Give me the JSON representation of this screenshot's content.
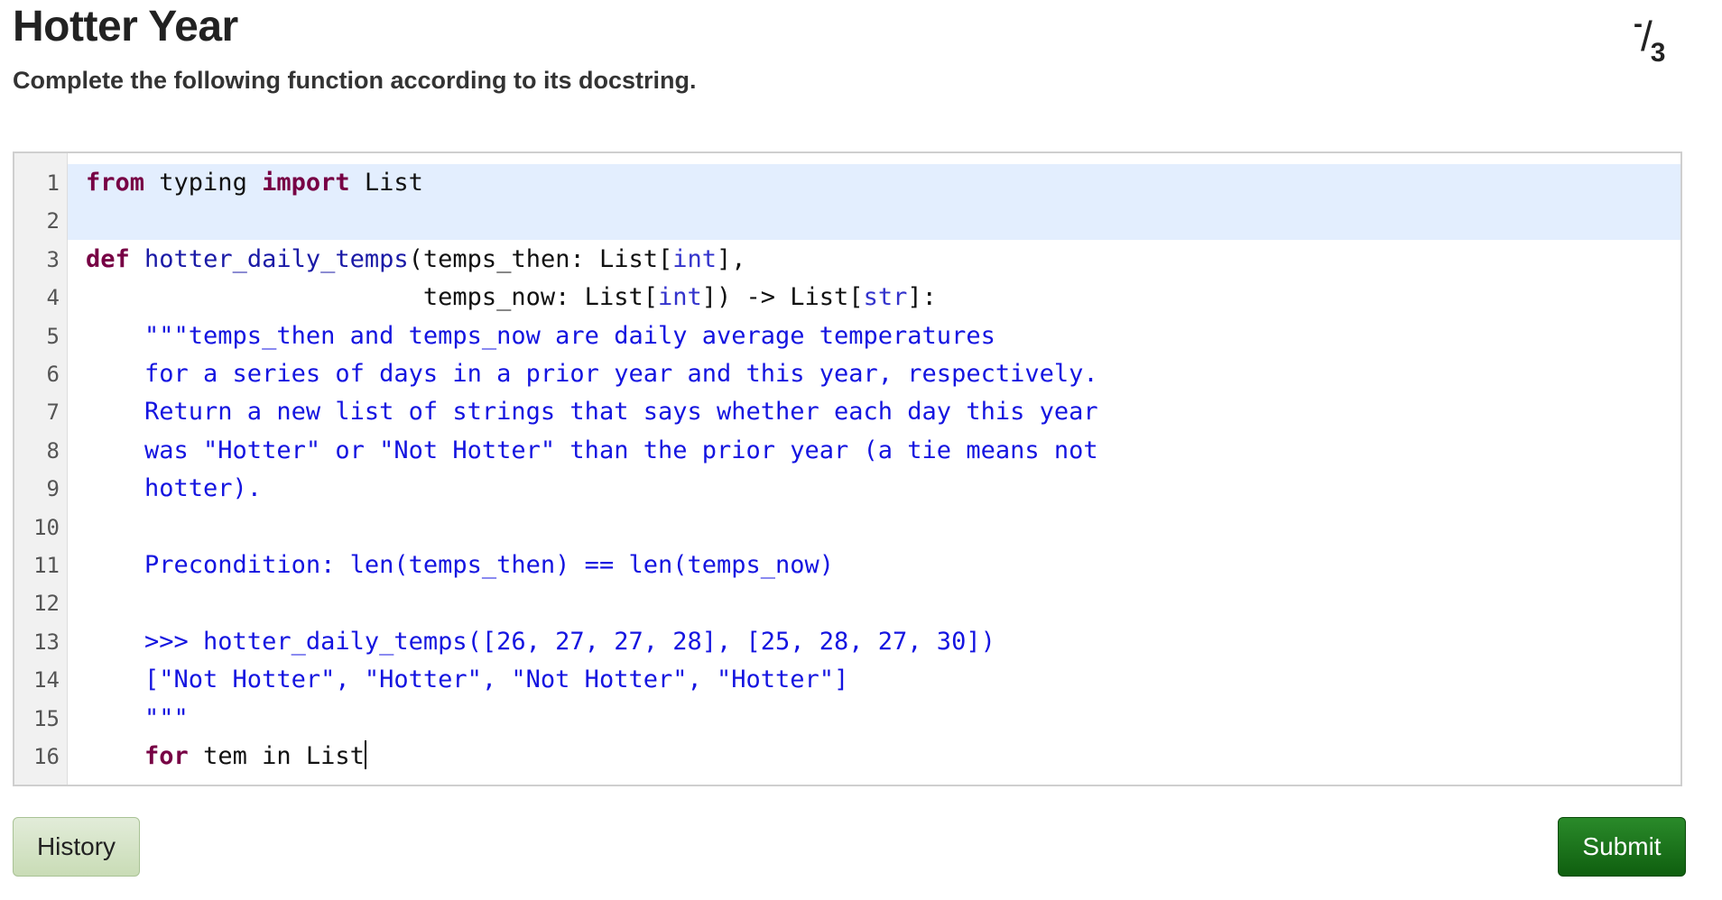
{
  "header": {
    "title": "Hotter Year",
    "score_numerator": "-",
    "score_slash": "/",
    "score_denominator": "3",
    "instructions": "Complete the following function according to its docstring."
  },
  "editor": {
    "lines": [
      {
        "num": "1",
        "tokens": [
          {
            "t": "from",
            "c": "kw"
          },
          {
            "t": " typing ",
            "c": ""
          },
          {
            "t": "import",
            "c": "kw"
          },
          {
            "t": " List",
            "c": ""
          }
        ]
      },
      {
        "num": "2",
        "tokens": []
      },
      {
        "num": "3",
        "tokens": [
          {
            "t": "def",
            "c": "kw"
          },
          {
            "t": " ",
            "c": ""
          },
          {
            "t": "hotter_daily_temps",
            "c": "fn"
          },
          {
            "t": "(temps_then: List[",
            "c": ""
          },
          {
            "t": "int",
            "c": "bi"
          },
          {
            "t": "],",
            "c": ""
          }
        ]
      },
      {
        "num": "4",
        "tokens": [
          {
            "t": "                       temps_now: List[",
            "c": ""
          },
          {
            "t": "int",
            "c": "bi"
          },
          {
            "t": "]) -> List[",
            "c": ""
          },
          {
            "t": "str",
            "c": "bi"
          },
          {
            "t": "]:",
            "c": ""
          }
        ]
      },
      {
        "num": "5",
        "tokens": [
          {
            "t": "    \"\"\"temps_then and temps_now are daily average temperatures",
            "c": "str"
          }
        ]
      },
      {
        "num": "6",
        "tokens": [
          {
            "t": "    for a series of days in a prior year and this year, respectively.",
            "c": "str"
          }
        ]
      },
      {
        "num": "7",
        "tokens": [
          {
            "t": "    Return a new list of strings that says whether each day this year",
            "c": "str"
          }
        ]
      },
      {
        "num": "8",
        "tokens": [
          {
            "t": "    was \"Hotter\" or \"Not Hotter\" than the prior year (a tie means not",
            "c": "str"
          }
        ]
      },
      {
        "num": "9",
        "tokens": [
          {
            "t": "    hotter).",
            "c": "str"
          }
        ]
      },
      {
        "num": "10",
        "tokens": []
      },
      {
        "num": "11",
        "tokens": [
          {
            "t": "    Precondition: len(temps_then) == len(temps_now)",
            "c": "str"
          }
        ]
      },
      {
        "num": "12",
        "tokens": []
      },
      {
        "num": "13",
        "tokens": [
          {
            "t": "    >>> hotter_daily_temps([26, 27, 27, 28], [25, 28, 27, 30])",
            "c": "str"
          }
        ]
      },
      {
        "num": "14",
        "tokens": [
          {
            "t": "    [\"Not Hotter\", \"Hotter\", \"Not Hotter\", \"Hotter\"]",
            "c": "str"
          }
        ]
      },
      {
        "num": "15",
        "tokens": [
          {
            "t": "    \"\"\"",
            "c": "str"
          }
        ]
      },
      {
        "num": "16",
        "tokens": [
          {
            "t": "    ",
            "c": ""
          },
          {
            "t": "for",
            "c": "kw"
          },
          {
            "t": " tem in List",
            "c": ""
          }
        ],
        "cursor": true
      }
    ]
  },
  "buttons": {
    "history_label": "History",
    "submit_label": "Submit"
  },
  "colors": {
    "keyword": "#770044",
    "string": "#1414e0",
    "active_line": "#e3eefe",
    "submit_bg": "#1a7a1a",
    "history_bg": "#d4e4c4"
  }
}
